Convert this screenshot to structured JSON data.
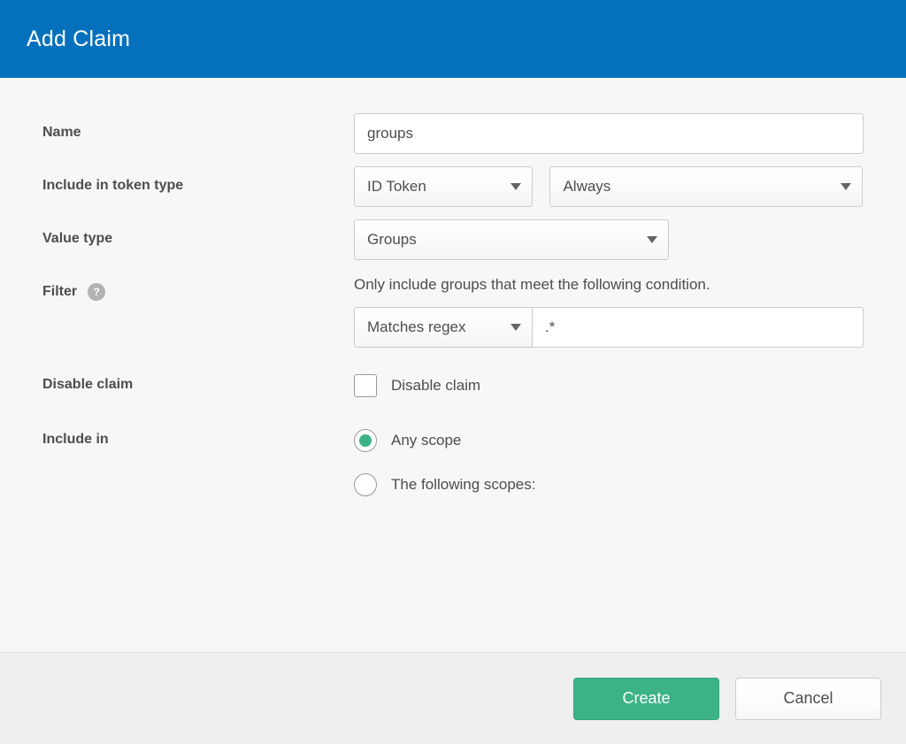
{
  "header": {
    "title": "Add Claim"
  },
  "form": {
    "name": {
      "label": "Name",
      "value": "groups",
      "placeholder": ""
    },
    "token_type": {
      "label": "Include in token type",
      "type_value": "ID Token",
      "when_value": "Always"
    },
    "value_type": {
      "label": "Value type",
      "value": "Groups"
    },
    "filter": {
      "label": "Filter",
      "help_icon": "question-mark-icon",
      "help_text": "?",
      "hint": "Only include groups that meet the following condition.",
      "operator_value": "Matches regex",
      "pattern_value": ".*",
      "pattern_placeholder": ""
    },
    "disable_claim": {
      "label": "Disable claim",
      "checkbox_label": "Disable claim",
      "checked": false
    },
    "include_in": {
      "label": "Include in",
      "options": [
        {
          "label": "Any scope",
          "selected": true
        },
        {
          "label": "The following scopes:",
          "selected": false
        }
      ]
    }
  },
  "footer": {
    "create_label": "Create",
    "cancel_label": "Cancel"
  },
  "colors": {
    "header_blue": "#0571bd",
    "accent_green": "#3cb387",
    "body_background": "#f7f7f7",
    "footer_background": "#efefef",
    "text": "#4d4d4d"
  }
}
